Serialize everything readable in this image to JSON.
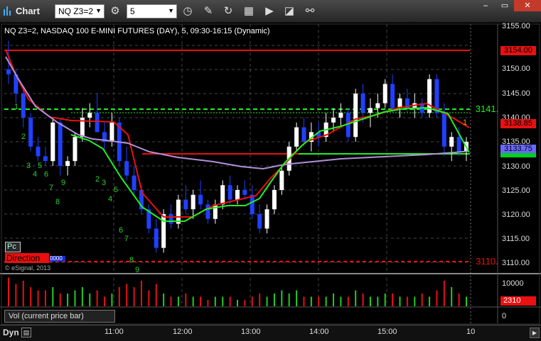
{
  "window": {
    "title": "Chart",
    "symbol": "NQ Z3=2",
    "interval": "5",
    "controls": {
      "minimize": "–",
      "restore": "▭",
      "close": "✕"
    }
  },
  "toolbar": {
    "icons": [
      "gear-icon",
      "clock-icon",
      "pencil-icon",
      "refresh-icon",
      "tool-icon",
      "play-icon",
      "chart-icon",
      "link-icon"
    ],
    "glyphs": {
      "gear": "⚙",
      "clock": "◷",
      "pencil": "✎",
      "refresh": "↻",
      "tool": "▦",
      "play": "▶",
      "chart": "◪",
      "link": "⚯"
    }
  },
  "chart": {
    "header": "NQ Z3=2, NASDAQ 100 E-MINI FUTURES (DAY), 5, 09:30-16:15 (Dynamic)",
    "price_axis": [
      "3155.00",
      "3150.00",
      "3145.00",
      "3140.00",
      "3135.00",
      "3130.00",
      "3125.00",
      "3120.00",
      "3115.00",
      "3110.00"
    ],
    "price_labels": {
      "level_top": "3154.00",
      "level_mid": "3138.85",
      "last": "3133.75",
      "green_line": "3141.",
      "red_line": "3110."
    },
    "pc_button": "Pc",
    "direction_badge": "Direction",
    "direction_sub": "0000",
    "copyright": "© eSignal, 2013",
    "counts": [
      {
        "t": "1",
        "c": "#33cc33"
      },
      {
        "t": "2",
        "c": "#33cc33"
      },
      {
        "t": "3",
        "c": "#33cc33"
      },
      {
        "t": "4",
        "c": "#33cc33"
      },
      {
        "t": "5",
        "c": "#33cc33"
      },
      {
        "t": "6",
        "c": "#33cc33"
      },
      {
        "t": "7",
        "c": "#33cc33"
      },
      {
        "t": "8",
        "c": "#33cc33"
      },
      {
        "t": "9",
        "c": "#33cc33"
      },
      {
        "t": "2",
        "c": "#33cc33"
      },
      {
        "t": "3",
        "c": "#33cc33"
      },
      {
        "t": "4",
        "c": "#33cc33"
      },
      {
        "t": "5",
        "c": "#33cc33"
      },
      {
        "t": "6",
        "c": "#33cc33"
      },
      {
        "t": "7",
        "c": "#33cc33"
      },
      {
        "t": "8",
        "c": "#33cc33"
      },
      {
        "t": "9",
        "c": "#33cc33"
      },
      {
        "t": "1",
        "c": "#ff9900"
      }
    ]
  },
  "volume": {
    "label": "Vol (current price bar)",
    "axis": [
      "10000",
      "0"
    ],
    "last": "2310"
  },
  "time_axis": [
    "11:00",
    "12:00",
    "13:00",
    "14:00",
    "15:00",
    "10"
  ],
  "bottom": {
    "mode": "Dyn",
    "mode_icon": "▤",
    "scroll": "▶"
  },
  "colors": {
    "up": "#ffffff",
    "down": "#2040ff",
    "red": "#e81010",
    "green": "#22ee22",
    "purple": "#b090d8",
    "grid": "#444444"
  }
}
